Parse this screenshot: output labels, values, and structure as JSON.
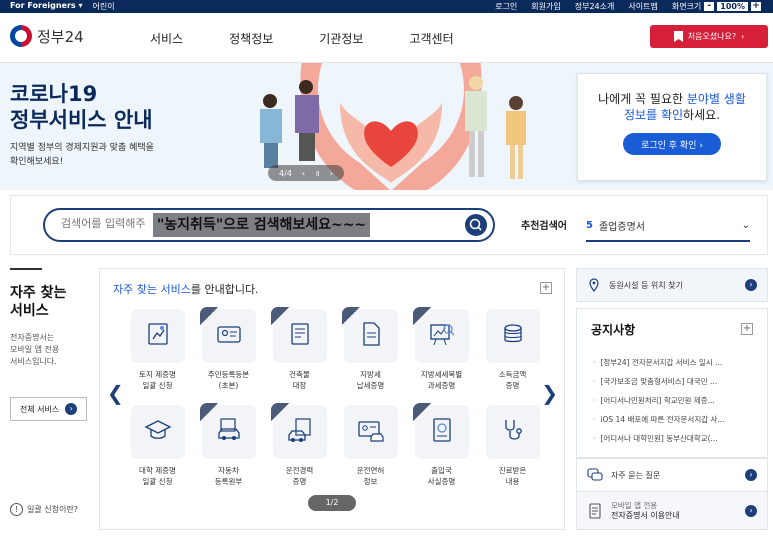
{
  "topbar": {
    "left": [
      "For Foreigners ▾",
      "어린이"
    ],
    "right": [
      "로그인",
      "회원가입",
      "정부24소개",
      "사이트맵"
    ],
    "zoom_label": "화면크기",
    "zoom_minus": "-",
    "zoom_value": "100%",
    "zoom_plus": "+"
  },
  "header": {
    "logo_text": "정부24",
    "nav": [
      "서비스",
      "정책정보",
      "기관정보",
      "고객센터"
    ],
    "first_visit": "처음오셨나요?"
  },
  "banner": {
    "title_line1": "코로나19",
    "title_line2": "정부서비스 안내",
    "desc_line1": "지역별 정부의 경제지원과 맞춤 혜택을",
    "desc_line2": "확인해보세요!",
    "pager": "4/4"
  },
  "login_card": {
    "line1_pre": "나에게 꼭 필요한 ",
    "line1_hl": "분야별 생활",
    "line2_hl": "정보를 확인",
    "line2_post": "하세요.",
    "button": "로그인 후 확인 ›"
  },
  "search": {
    "placeholder": "검색어를 입력해주",
    "overlay": "\"농지취득\"으로 검색해보세요~~~",
    "rec_label": "추천검색어",
    "rec_num": "5",
    "rec_value": "졸업증명서"
  },
  "freq": {
    "title_line1": "자주 찾는",
    "title_line2": "서비스",
    "desc_line1": "전자증명서는",
    "desc_line2": "모바일 앱 전용",
    "desc_line3": "서비스입니다.",
    "all_button": "전체 서비스",
    "how_link": "일괄 신청이란?"
  },
  "services": {
    "head_blue": "자주 찾는 서비스",
    "head_rest": "를 안내합니다.",
    "page": "1/2",
    "items": [
      {
        "l1": "토지 제증명",
        "l2": "일괄 신청",
        "icon": "map-doc-icon",
        "ribbon": false
      },
      {
        "l1": "주민등록등본",
        "l2": "(초본)",
        "icon": "id-card-icon",
        "ribbon": true
      },
      {
        "l1": "건축물",
        "l2": "대장",
        "icon": "building-register-icon",
        "ribbon": true
      },
      {
        "l1": "지방세",
        "l2": "납세증명",
        "icon": "tax-doc-icon",
        "ribbon": true
      },
      {
        "l1": "지방세세목별",
        "l2": "과세증명",
        "icon": "tax-chart-icon",
        "ribbon": true
      },
      {
        "l1": "소득금액",
        "l2": "증명",
        "icon": "coins-icon",
        "ribbon": false
      },
      {
        "l1": "대학 제증명",
        "l2": "일괄 신청",
        "icon": "graduation-cap-icon",
        "ribbon": false
      },
      {
        "l1": "자동차",
        "l2": "등록원부",
        "icon": "car-register-icon",
        "ribbon": true
      },
      {
        "l1": "운전경력",
        "l2": "증명",
        "icon": "driving-record-icon",
        "ribbon": true
      },
      {
        "l1": "운전면허",
        "l2": "정보",
        "icon": "license-icon",
        "ribbon": false
      },
      {
        "l1": "출입국",
        "l2": "사실증명",
        "icon": "passport-icon",
        "ribbon": true
      },
      {
        "l1": "진료받은",
        "l2": "내용",
        "icon": "stethoscope-icon",
        "ribbon": false
      }
    ]
  },
  "right": {
    "facility": "동원시설 등 위치 찾기",
    "notice_title": "공지사항",
    "notices": [
      "[정부24] 전자문서지갑 서비스 일시 ...",
      "[국가보조금 맞춤형서비스] 대국민 ...",
      "[어디서나민원처리] 학교민원 제증...",
      "iOS 14 배포에 따른 전자문서지갑 사...",
      "[어디서나 대학민원] 동부산대학교(..."
    ],
    "faq": "자주 묻는 질문",
    "mobile_line1": "모바일 앱 전용",
    "mobile_line2": "전자증명서 이용안내"
  },
  "colors": {
    "navy": "#0b2a5c",
    "accent_blue": "#1a5bd6",
    "red_button": "#d6203a"
  }
}
